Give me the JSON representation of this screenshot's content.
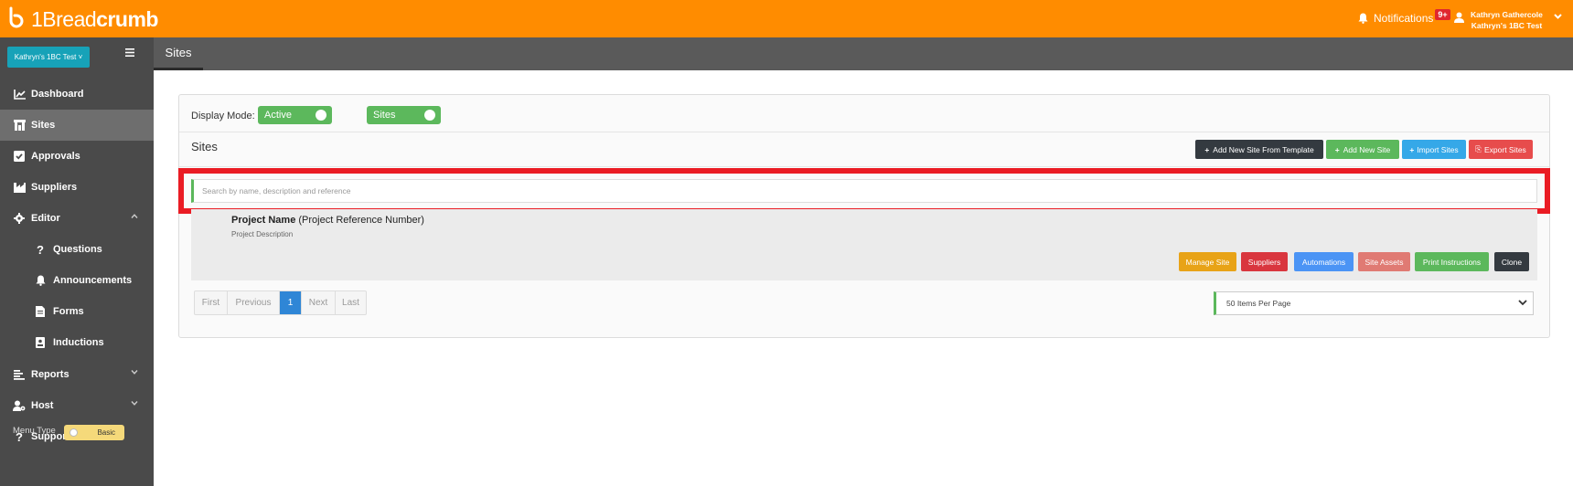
{
  "app": {
    "logo_text_prefix": "1Bread",
    "logo_text_bold": "crumb",
    "notifications_label": "Notifications",
    "notifications_badge": "9+",
    "user_name": "Kathryn Gathercole",
    "user_org": "Kathryn's 1BC Test"
  },
  "sidebar": {
    "account_label": "Kathryn's 1BC Test",
    "items": [
      {
        "label": "Dashboard",
        "icon": "chart-line-icon"
      },
      {
        "label": "Sites",
        "icon": "building-icon",
        "active": true
      },
      {
        "label": "Approvals",
        "icon": "check-square-icon"
      },
      {
        "label": "Suppliers",
        "icon": "industry-icon"
      },
      {
        "label": "Editor",
        "icon": "gear-icon",
        "expanded": true
      },
      {
        "label": "Questions",
        "icon": "question-icon"
      },
      {
        "label": "Announcements",
        "icon": "bell-icon"
      },
      {
        "label": "Forms",
        "icon": "file-icon"
      },
      {
        "label": "Inductions",
        "icon": "id-badge-icon"
      },
      {
        "label": "Reports",
        "icon": "list-icon"
      },
      {
        "label": "Host",
        "icon": "user-gear-icon"
      },
      {
        "label": "Support",
        "icon": "question-icon"
      }
    ],
    "menu_type_label": "Menu Type",
    "menu_type_value": "Basic"
  },
  "header": {
    "tab_label": "Sites"
  },
  "main": {
    "display_mode_label": "Display Mode:",
    "toggle_active": "Active",
    "toggle_sites": "Sites",
    "section_title": "Sites",
    "actions": {
      "add_from_template": "Add New Site From Template",
      "add_new": "Add New Site",
      "import": "Import Sites",
      "export": "Export Sites"
    },
    "search_placeholder": "Search by name, description and reference",
    "project": {
      "name": "Project Name",
      "reference": "(Project Reference Number)",
      "description": "Project Description",
      "buttons": {
        "manage": "Manage Site",
        "suppliers": "Suppliers",
        "automations": "Automations",
        "assets": "Site Assets",
        "print": "Print Instructions",
        "clone": "Clone"
      }
    },
    "pager": {
      "first": "First",
      "previous": "Previous",
      "current": "1",
      "next": "Next",
      "last": "Last"
    },
    "per_page": "50 Items Per Page"
  },
  "colors": {
    "brand_orange": "#ff8c00",
    "sidebar_bg": "#4a4a4a",
    "green": "#5cb85c",
    "highlight_red": "#ea1c24"
  }
}
